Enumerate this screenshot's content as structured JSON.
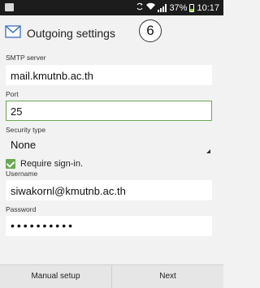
{
  "status_bar": {
    "battery_percent": "37%",
    "time": "10:17",
    "icons": [
      "app-notification-icon",
      "sync-icon",
      "wifi-icon",
      "signal-icon",
      "battery-icon"
    ]
  },
  "header": {
    "title": "Outgoing settings",
    "icon": "envelope-icon",
    "step_badge": "6"
  },
  "form": {
    "smtp_server_label": "SMTP server",
    "smtp_server_value": "mail.kmutnb.ac.th",
    "port_label": "Port",
    "port_value": "25",
    "security_type_label": "Security type",
    "security_type_value": "None",
    "require_signin_label": "Require sign-in.",
    "require_signin_checked": true,
    "username_label": "Username",
    "username_value": "siwakornl@kmutnb.ac.th",
    "password_label": "Password",
    "password_value": "••••••••••"
  },
  "bottom_bar": {
    "manual_setup_label": "Manual setup",
    "next_label": "Next"
  },
  "colors": {
    "accent_green": "#6aa84f",
    "status_bar_bg": "#1c1c1c"
  }
}
